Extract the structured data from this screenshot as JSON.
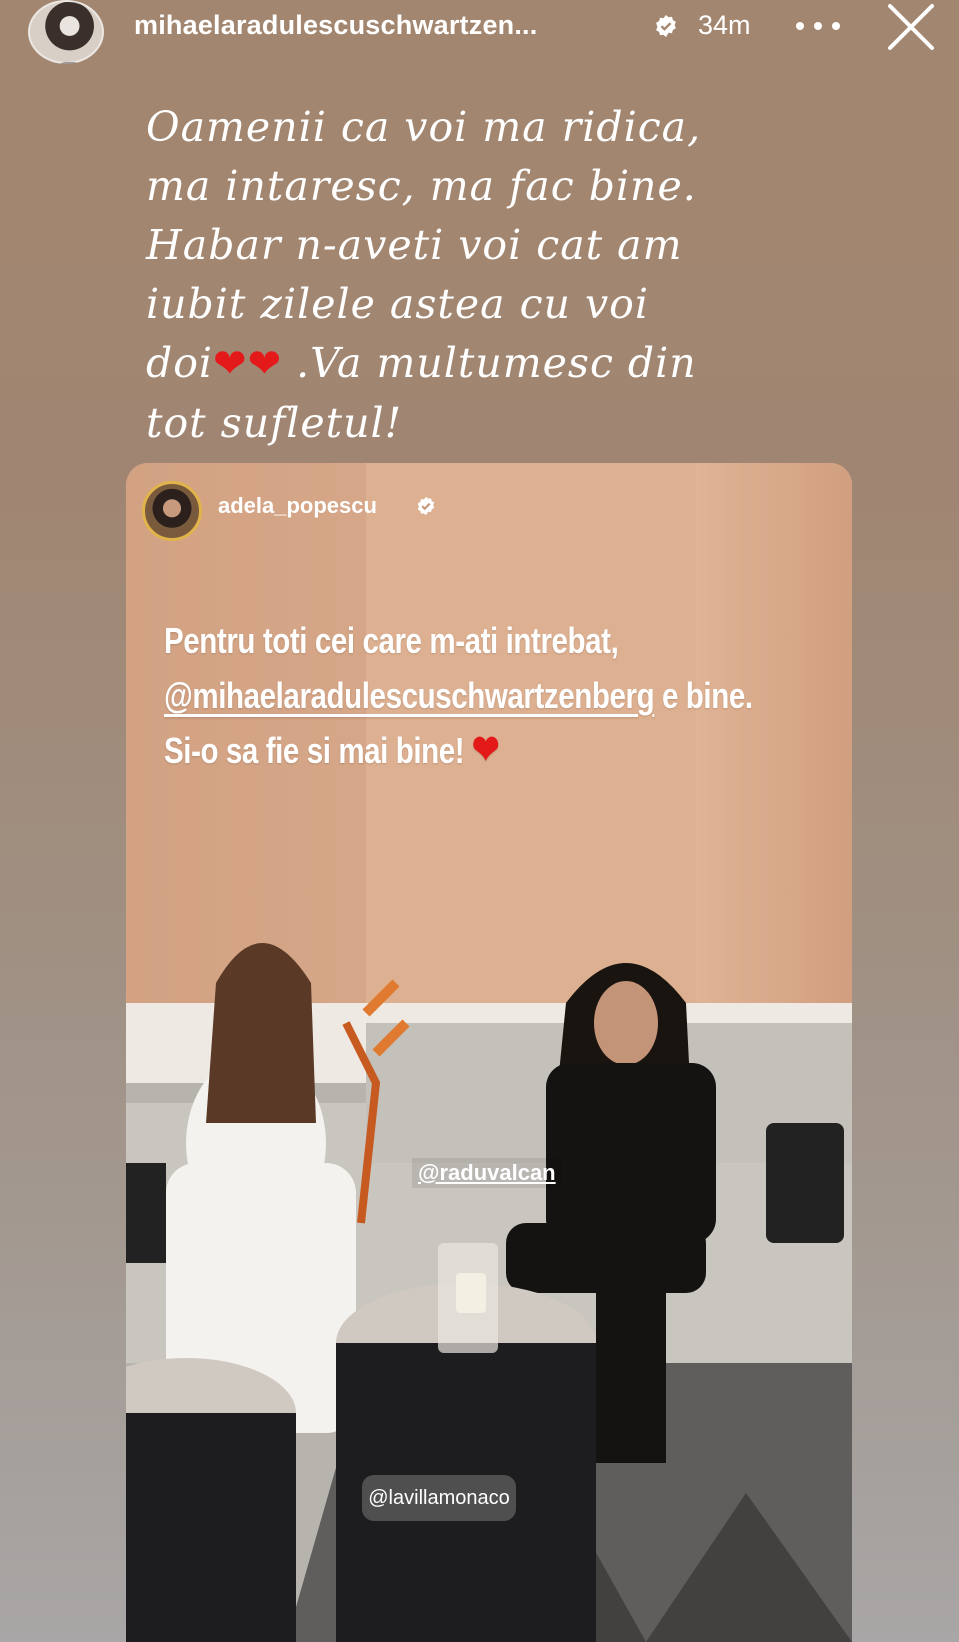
{
  "story": {
    "username": "mihaelaradulescuschwartzen...",
    "time": "34m",
    "caption_lines": [
      "Oamenii ca voi ma ridica,",
      "ma intaresc, ma fac bine.",
      "Habar n-aveti voi cat am",
      "iubit zilele astea cu voi",
      "doi",
      ".Va multumesc din",
      "tot sufletul!"
    ],
    "caption_hearts": "❤❤"
  },
  "shared_post": {
    "username": "adela_popescu",
    "text_line1": "Pentru toti cei care m-ati intrebat,",
    "mention": "@mihaelaradulescuschwartzenberg",
    "text_line2_suffix": " e bine.",
    "text_line3": "Si-o sa fie si mai bine!",
    "heart": "❤",
    "tag_person": "@raduvalcan",
    "tag_location": "@lavillamonaco"
  },
  "colors": {
    "background_top": "#a3866f",
    "background_bottom": "#a8a6a6",
    "heart": "#e41a1a",
    "text": "#ffffff"
  },
  "icons": [
    "verified-badge-icon",
    "more-options-icon",
    "close-icon"
  ]
}
